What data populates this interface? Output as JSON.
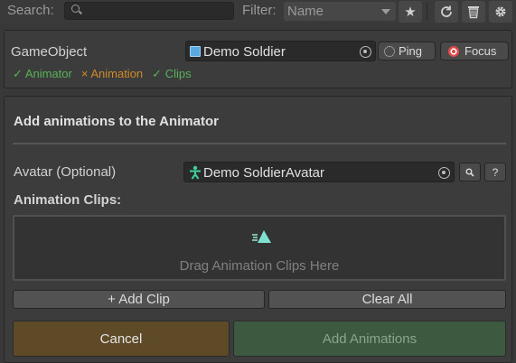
{
  "toolbar": {
    "search_label": "Search:",
    "search_value": "",
    "filter_label": "Filter:",
    "filter_selected": "Name",
    "icons": [
      "search-icon",
      "star-icon",
      "refresh-icon",
      "trash-icon",
      "gear-icon"
    ]
  },
  "gameobject": {
    "label": "GameObject",
    "value": "Demo Soldier",
    "ping_label": "Ping",
    "focus_label": "Focus",
    "status": [
      {
        "mark": "✓",
        "label": "Animator",
        "ok": true
      },
      {
        "mark": "×",
        "label": "Animation",
        "ok": false
      },
      {
        "mark": "✓",
        "label": "Clips",
        "ok": true
      }
    ]
  },
  "main": {
    "header": "Add animations to the Animator",
    "avatar_label": "Avatar (Optional)",
    "avatar_value": "Demo SoldierAvatar",
    "help_label": "?",
    "clips_label": "Animation Clips:",
    "drop_text": "Drag Animation Clips Here",
    "add_clip_label": "+ Add Clip",
    "clear_all_label": "Clear All",
    "cancel_label": "Cancel",
    "add_animations_label": "Add Animations"
  },
  "colors": {
    "ok": "#58b058",
    "bad": "#d08a2a",
    "cancel_bg": "#5e4a26",
    "add_bg": "#3d5a40",
    "accent_cyan": "#3fd09a"
  }
}
